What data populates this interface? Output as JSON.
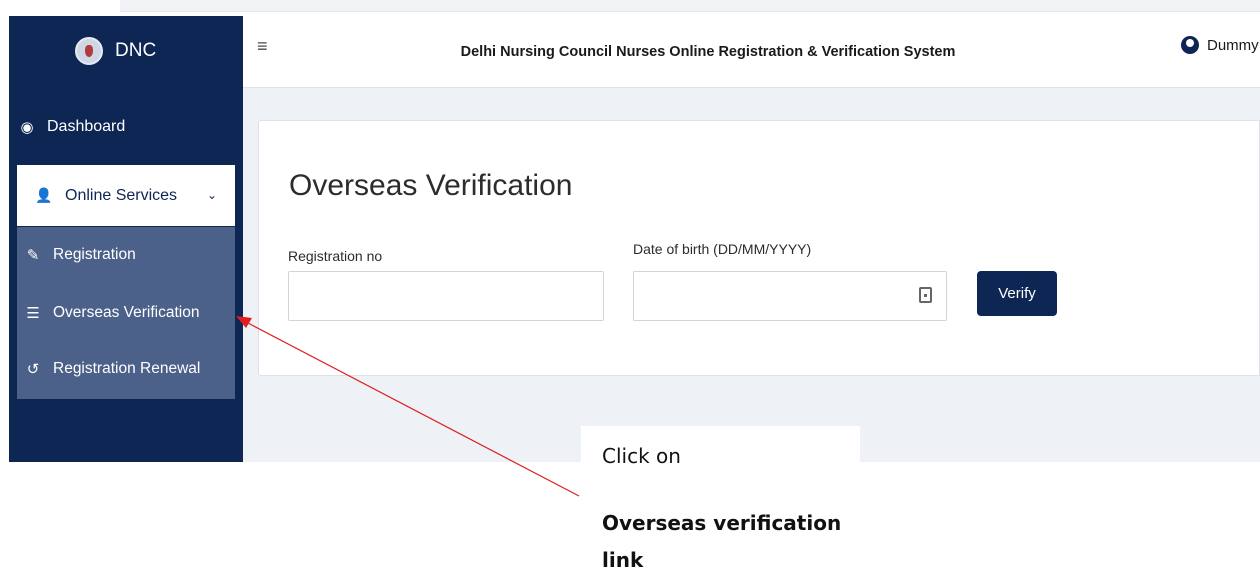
{
  "brand": {
    "name": "DNC"
  },
  "header": {
    "title": "Delhi Nursing Council Nurses Online Registration & Verification System",
    "user_name": "Dummy F"
  },
  "sidebar": {
    "dashboard": "Dashboard",
    "online_services": "Online Services",
    "submenu": [
      {
        "label": "Registration",
        "icon": "edit-icon"
      },
      {
        "label": "Overseas Verification",
        "icon": "list-icon"
      },
      {
        "label": "Registration Renewal",
        "icon": "undo-icon"
      }
    ]
  },
  "main": {
    "title": "Overseas Verification",
    "registration_label": "Registration no",
    "dob_label": "Date of birth (DD/MM/YYYY)",
    "verify_label": "Verify"
  },
  "annotation": {
    "line1": "Click on",
    "line2": "Overseas verification link",
    "color": "#e01e1e"
  },
  "colors": {
    "sidebar": "#0d2654",
    "submenu": "#4c6189",
    "accent": "#0d2654"
  }
}
